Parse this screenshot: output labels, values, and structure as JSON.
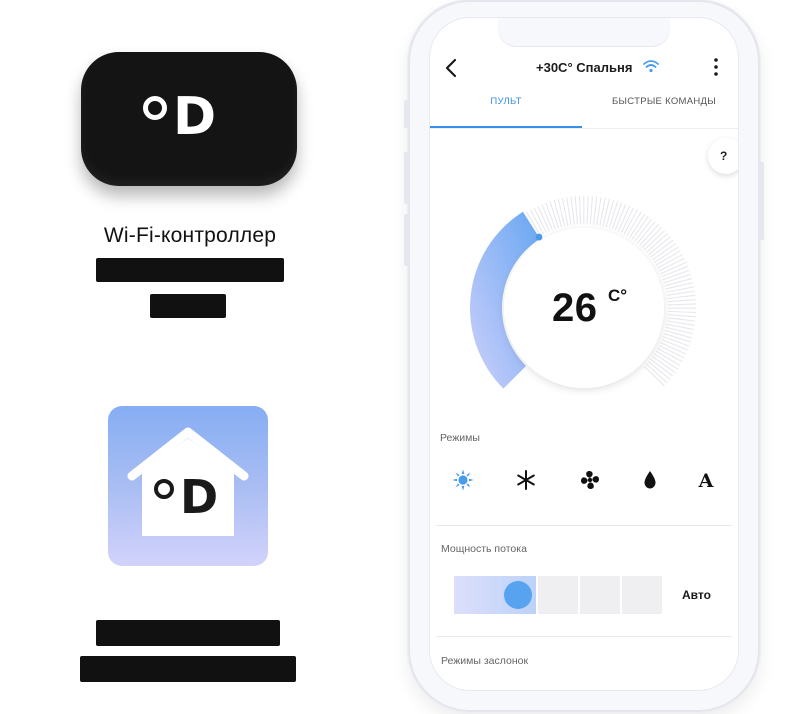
{
  "left": {
    "device_caption_line1": "Wi-Fi-контроллер",
    "device_logo_letter": "D",
    "app_icon_logo_letter": "D"
  },
  "app": {
    "title": "+30C° Спальня",
    "tabs": [
      "ПУЛЬТ",
      "БЫСТРЫЕ КОМАНДЫ"
    ],
    "active_tab": "ПУЛЬТ",
    "help_label": "?",
    "temperature": {
      "value": "26",
      "unit": "C°",
      "level": 0.38
    },
    "modes_label": "Режимы",
    "modes": [
      {
        "name": "heat",
        "icon": "sun-icon",
        "active": true
      },
      {
        "name": "cool",
        "icon": "snowflake-icon",
        "active": false
      },
      {
        "name": "fan",
        "icon": "fan-icon",
        "active": false
      },
      {
        "name": "dry",
        "icon": "drop-icon",
        "active": false
      },
      {
        "name": "auto",
        "icon": "auto-icon",
        "label": "A",
        "active": false
      }
    ],
    "flow_label": "Мощность потока",
    "flow_auto_label": "Авто",
    "flow_level": 1,
    "flow_steps": 4,
    "shutter_label": "Режимы заслонок"
  },
  "colors": {
    "accent": "#3a8ee6",
    "gauge_start": "#c9ccfb",
    "gauge_end": "#6ea8f2",
    "device_body": "#141414"
  }
}
